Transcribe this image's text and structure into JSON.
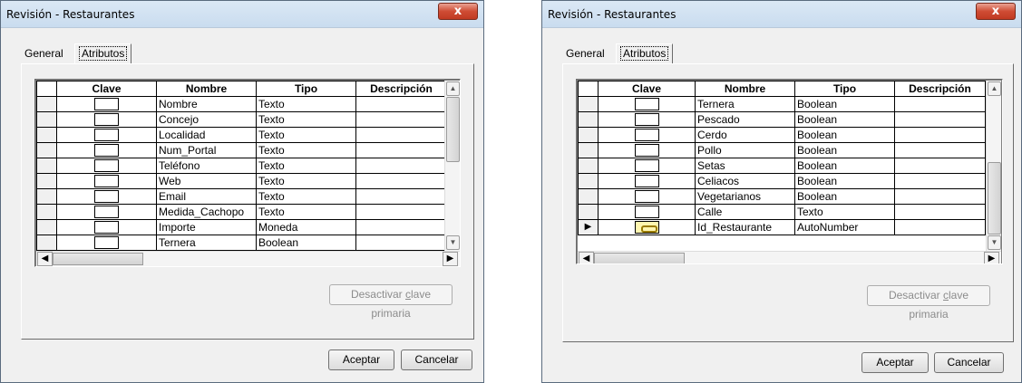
{
  "dialogs": [
    {
      "title": "Revisión - Restaurantes",
      "close_label": "x",
      "tabs": {
        "general": "General",
        "atributos": "Atributos"
      },
      "columns": [
        "Clave",
        "Nombre",
        "Tipo",
        "Descripción"
      ],
      "rows": [
        {
          "nombre": "Nombre",
          "tipo": "Texto"
        },
        {
          "nombre": "Concejo",
          "tipo": "Texto"
        },
        {
          "nombre": "Localidad",
          "tipo": "Texto"
        },
        {
          "nombre": "Num_Portal",
          "tipo": "Texto"
        },
        {
          "nombre": "Teléfono",
          "tipo": "Texto"
        },
        {
          "nombre": "Web",
          "tipo": "Texto"
        },
        {
          "nombre": "Email",
          "tipo": "Texto"
        },
        {
          "nombre": "Medida_Cachopo",
          "tipo": "Texto"
        },
        {
          "nombre": "Importe",
          "tipo": "Moneda"
        },
        {
          "nombre": "Ternera",
          "tipo": "Boolean"
        }
      ],
      "pk_button": {
        "pre": "Desactivar ",
        "u": "c",
        "post": "lave primaria"
      },
      "ok_label": "Aceptar",
      "cancel_label": "Cancelar"
    },
    {
      "title": "Revisión - Restaurantes",
      "close_label": "x",
      "tabs": {
        "general": "General",
        "atributos": "Atributos"
      },
      "columns": [
        "Clave",
        "Nombre",
        "Tipo",
        "Descripción"
      ],
      "rows": [
        {
          "nombre": "Ternera",
          "tipo": "Boolean"
        },
        {
          "nombre": "Pescado",
          "tipo": "Boolean"
        },
        {
          "nombre": "Cerdo",
          "tipo": "Boolean"
        },
        {
          "nombre": "Pollo",
          "tipo": "Boolean"
        },
        {
          "nombre": "Setas",
          "tipo": "Boolean"
        },
        {
          "nombre": "Celiacos",
          "tipo": "Boolean"
        },
        {
          "nombre": "Vegetarianos",
          "tipo": "Boolean"
        },
        {
          "nombre": "Calle",
          "tipo": "Texto"
        },
        {
          "nombre": "Id_Restaurante",
          "tipo": "AutoNumber",
          "key": true,
          "current": true
        }
      ],
      "pk_button": {
        "pre": "Desactivar ",
        "u": "c",
        "post": "lave primaria"
      },
      "ok_label": "Aceptar",
      "cancel_label": "Cancelar"
    }
  ],
  "icons": {
    "current_row": "right-triangle",
    "primary_key": "key-icon"
  }
}
